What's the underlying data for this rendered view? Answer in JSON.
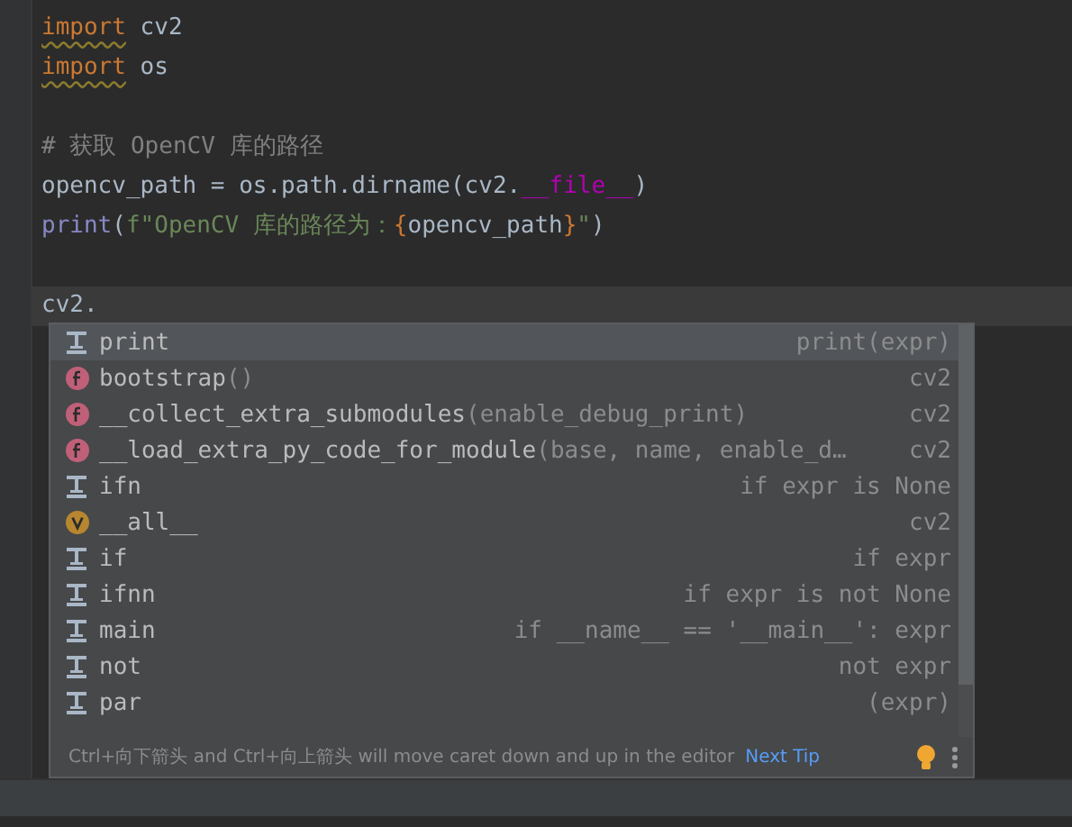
{
  "editor": {
    "lines": [
      {
        "segments": [
          {
            "text": "import",
            "kind": "keyword",
            "warning": true
          },
          {
            "text": " cv2",
            "kind": "plain",
            "warning": false
          }
        ]
      },
      {
        "segments": [
          {
            "text": "import",
            "kind": "keyword",
            "warning": true
          },
          {
            "text": " os",
            "kind": "plain",
            "warning": false
          }
        ]
      },
      {
        "blank_before": true,
        "segments": [
          {
            "text": "# 获取 OpenCV 库的路径",
            "kind": "comment",
            "warning": false
          }
        ]
      },
      {
        "segments": [
          {
            "text": "opencv_path = os.path.dirname(cv2.",
            "kind": "plain",
            "warning": false
          },
          {
            "text": "__file__",
            "kind": "dunder",
            "warning": false
          },
          {
            "text": ")",
            "kind": "plain",
            "warning": false
          }
        ]
      },
      {
        "segments": [
          {
            "text": "print",
            "kind": "builtin",
            "warning": false
          },
          {
            "text": "(",
            "kind": "plain",
            "warning": false
          },
          {
            "text": "f\"OpenCV 库的路径为：",
            "kind": "string",
            "warning": false
          },
          {
            "text": "{",
            "kind": "keyword",
            "warning": false
          },
          {
            "text": "opencv_path",
            "kind": "plain",
            "warning": false
          },
          {
            "text": "}",
            "kind": "keyword",
            "warning": false
          },
          {
            "text": "\"",
            "kind": "string",
            "warning": false
          },
          {
            "text": ")",
            "kind": "plain",
            "warning": false
          }
        ]
      },
      {
        "blank_before": true,
        "current": true,
        "segments": [
          {
            "text": "cv2.",
            "kind": "plain",
            "warning": false
          }
        ]
      }
    ]
  },
  "completion": {
    "items": [
      {
        "kind": "template",
        "name": "print",
        "type": "print(expr)",
        "selected": true
      },
      {
        "kind": "function",
        "name": "bootstrap",
        "params": "()",
        "type": "cv2",
        "selected": false
      },
      {
        "kind": "function",
        "name": "__collect_extra_submodules",
        "params": "(enable_debug_print)",
        "type": "cv2",
        "selected": false
      },
      {
        "kind": "function",
        "name": "__load_extra_py_code_for_module",
        "params": "(base, name, enable_d…",
        "type": "cv2",
        "selected": false
      },
      {
        "kind": "template",
        "name": "ifn",
        "type": "if expr is None",
        "selected": false
      },
      {
        "kind": "variable",
        "name": "__all__",
        "type": "cv2",
        "selected": false
      },
      {
        "kind": "template",
        "name": "if",
        "type": "if expr",
        "selected": false
      },
      {
        "kind": "template",
        "name": "ifnn",
        "type": "if expr is not None",
        "selected": false
      },
      {
        "kind": "template",
        "name": "main",
        "type": "if __name__ == '__main__': expr",
        "selected": false
      },
      {
        "kind": "template",
        "name": "not",
        "type": "not expr",
        "selected": false
      },
      {
        "kind": "template",
        "name": "par",
        "type": "(expr)",
        "selected": false
      }
    ],
    "tip": "Ctrl+向下箭头 and Ctrl+向上箭头 will move caret down and up in the editor",
    "next_tip": "Next Tip"
  }
}
